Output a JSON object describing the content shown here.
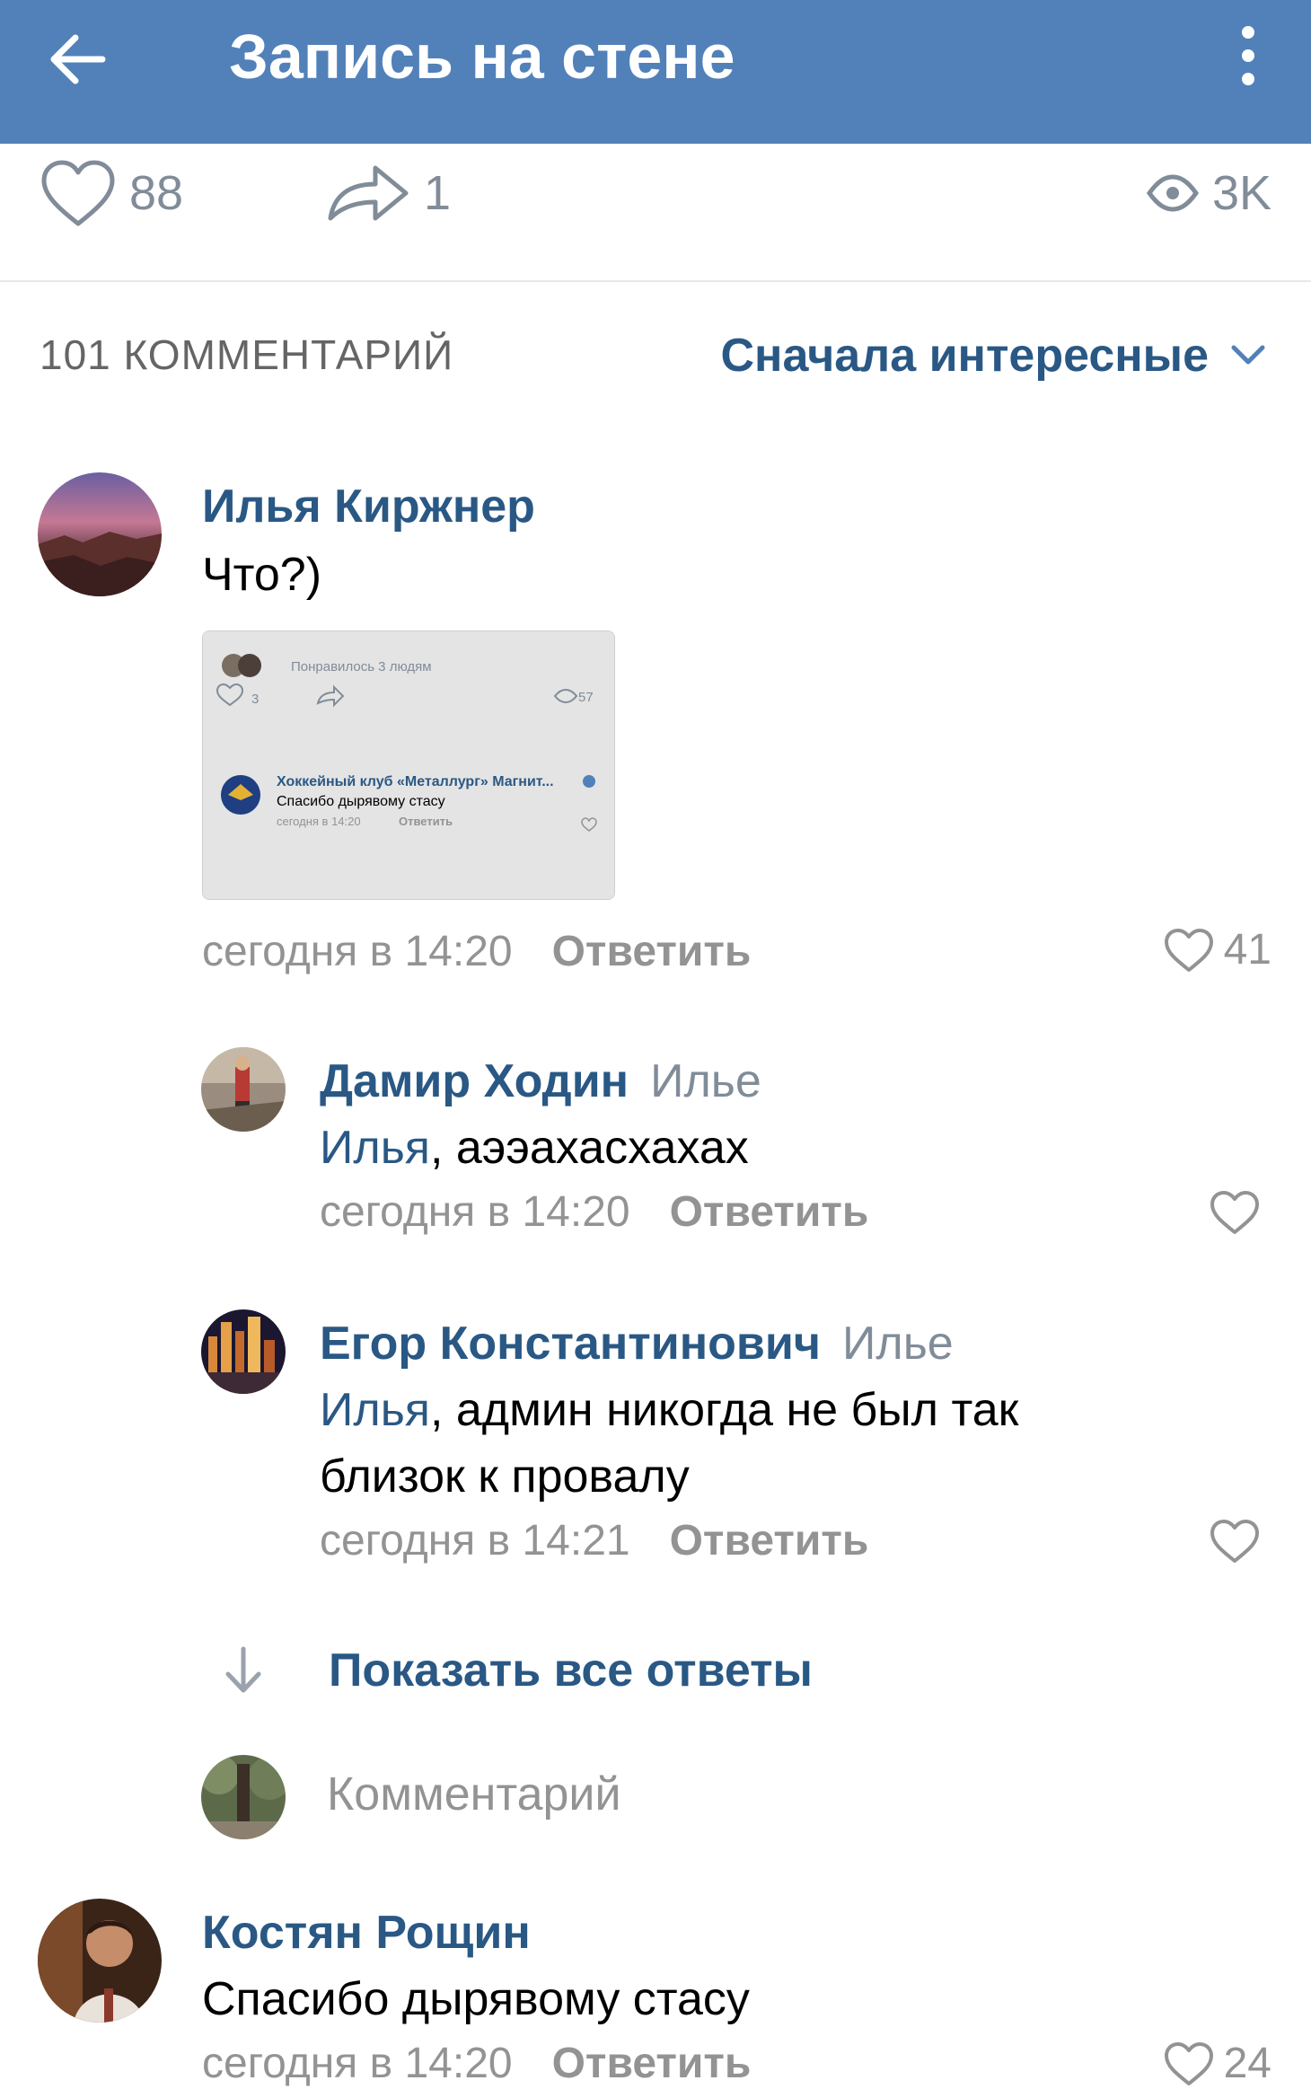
{
  "header": {
    "title": "Запись на стене",
    "back_icon": "arrow-left-icon",
    "menu_icon": "more-vertical-icon",
    "bg_color": "#5181b8"
  },
  "stats": {
    "likes": "88",
    "shares": "1",
    "views": "3K"
  },
  "comments": {
    "count_label": "101 КОММЕНТАРИЙ",
    "sort_label": "Сначала интересные",
    "items": [
      {
        "author": "Илья Киржнер",
        "text": "Что?)",
        "time": "сегодня в 14:20",
        "reply": "Ответить",
        "likes": "41",
        "attachment": {
          "liked_by": "Понравилось 3 людям",
          "likes": "3",
          "views": "57",
          "club": "Хоккейный клуб «Металлург» Магнит...",
          "text": "Спасибо дырявому стасу",
          "time": "сегодня в 14:20",
          "reply": "Ответить"
        }
      },
      {
        "author": "Дамир Ходин",
        "to": "Илье",
        "mention": "Илья",
        "text": ", аээахасхахах",
        "time": "сегодня в 14:20",
        "reply": "Ответить"
      },
      {
        "author": "Егор Константинович",
        "to": "Илье",
        "mention": "Илья",
        "text_line1": ", админ никогда не был так",
        "text_line2": "близок к провалу",
        "time": "сегодня в 14:21",
        "reply": "Ответить"
      },
      {
        "author": "Костян Рощин",
        "text": "Спасибо дырявому стасу",
        "time": "сегодня в 14:20",
        "reply": "Ответить",
        "likes": "24"
      }
    ],
    "show_all_label": "Показать все ответы",
    "input_placeholder": "Комментарий"
  }
}
